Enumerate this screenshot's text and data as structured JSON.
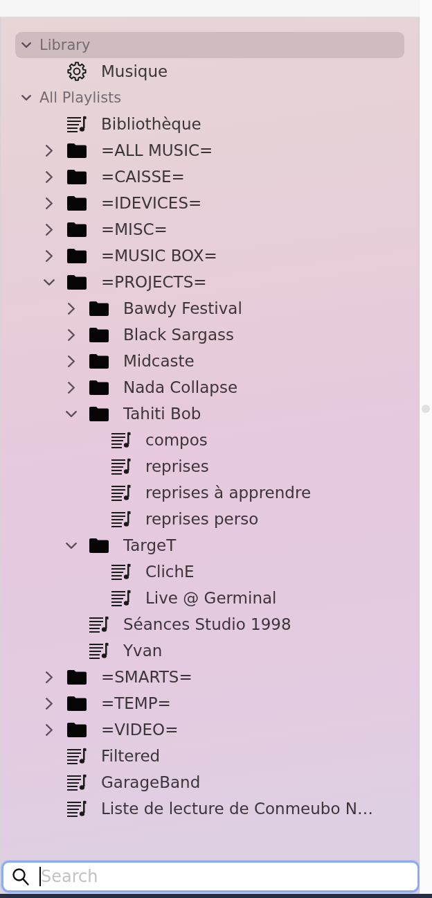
{
  "sidebar": {
    "sections": [
      {
        "title": "Library",
        "expanded": true,
        "selected": true,
        "items": [
          {
            "kind": "smart",
            "label": "Musique"
          }
        ]
      },
      {
        "title": "All Playlists",
        "expanded": true,
        "selected": false,
        "items": [
          {
            "kind": "playlist",
            "label": "Bibliothèque"
          },
          {
            "kind": "folder",
            "label": "=ALL MUSIC=",
            "expanded": false
          },
          {
            "kind": "folder",
            "label": "=CAISSE=",
            "expanded": false
          },
          {
            "kind": "folder",
            "label": "=IDEVICES=",
            "expanded": false
          },
          {
            "kind": "folder",
            "label": "=MISC=",
            "expanded": false
          },
          {
            "kind": "folder",
            "label": "=MUSIC BOX=",
            "expanded": false
          },
          {
            "kind": "folder",
            "label": "=PROJECTS=",
            "expanded": true,
            "children": [
              {
                "kind": "folder",
                "label": "Bawdy Festival",
                "expanded": false
              },
              {
                "kind": "folder",
                "label": "Black Sargass",
                "expanded": false
              },
              {
                "kind": "folder",
                "label": "Midcaste",
                "expanded": false
              },
              {
                "kind": "folder",
                "label": "Nada Collapse",
                "expanded": false
              },
              {
                "kind": "folder",
                "label": "Tahiti Bob",
                "expanded": true,
                "children": [
                  {
                    "kind": "playlist",
                    "label": "compos"
                  },
                  {
                    "kind": "playlist",
                    "label": "reprises"
                  },
                  {
                    "kind": "playlist",
                    "label": "reprises à apprendre"
                  },
                  {
                    "kind": "playlist",
                    "label": "reprises perso"
                  }
                ]
              },
              {
                "kind": "folder",
                "label": "TargeT",
                "expanded": true,
                "children": [
                  {
                    "kind": "playlist",
                    "label": "ClichE"
                  },
                  {
                    "kind": "playlist",
                    "label": "Live @ Germinal"
                  }
                ]
              },
              {
                "kind": "playlist",
                "label": "Séances Studio 1998"
              },
              {
                "kind": "playlist",
                "label": "Yvan"
              }
            ]
          },
          {
            "kind": "folder",
            "label": "=SMARTS=",
            "expanded": false
          },
          {
            "kind": "folder",
            "label": "=TEMP=",
            "expanded": false
          },
          {
            "kind": "folder",
            "label": "=VIDEO=",
            "expanded": false
          },
          {
            "kind": "playlist",
            "label": "Filtered"
          },
          {
            "kind": "playlist",
            "label": "GarageBand"
          },
          {
            "kind": "playlist",
            "label": "Liste de lecture de Conmeubo N…"
          }
        ]
      }
    ]
  },
  "search": {
    "placeholder": "Search",
    "focused": true
  }
}
